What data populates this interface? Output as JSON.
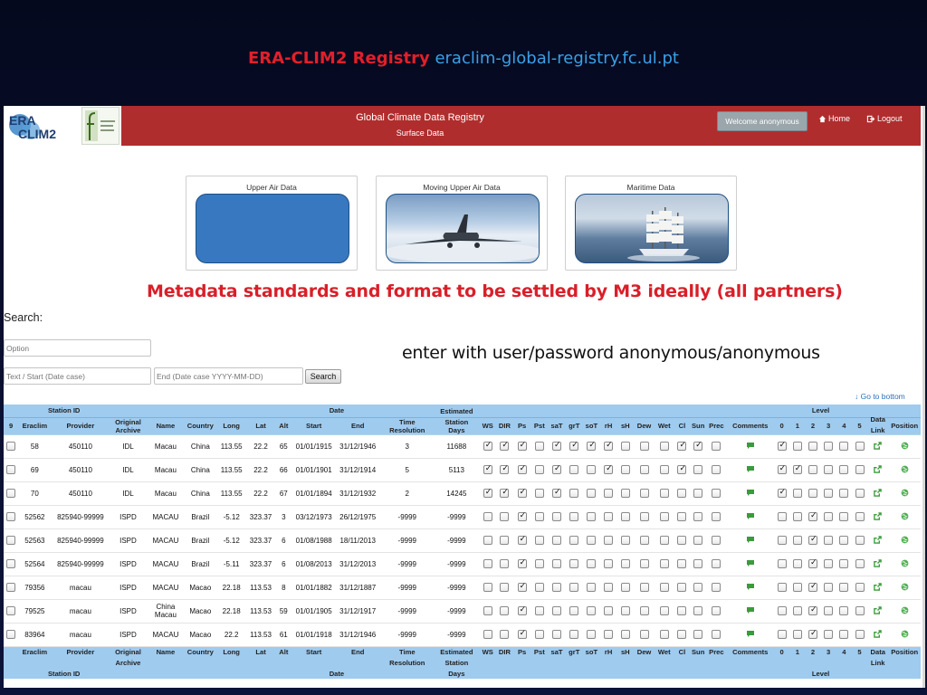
{
  "slide": {
    "title_red": "ERA-CLIM2 Registry",
    "title_blue": "eraclim-global-registry.fc.ul.pt",
    "note_red": "Metadata standards and format to be settled by M3 ideally (all partners)",
    "note_black": "enter with user/password anonymous/anonymous"
  },
  "navbar": {
    "title": "Global Climate Data Registry",
    "subtitle": "Surface Data",
    "welcome": "Welcome anonymous",
    "home": "Home",
    "logout": "Logout",
    "logo_text_era": "ERA",
    "logo_text_clim": "CLIM2"
  },
  "cards": [
    {
      "label": "Upper Air Data"
    },
    {
      "label": "Moving Upper Air Data"
    },
    {
      "label": "Maritime Data"
    }
  ],
  "search": {
    "label": "Search:",
    "option_placeholder": "Option",
    "start_placeholder": "Text / Start (Date case)",
    "end_placeholder": "End (Date case YYYY-MM-DD)",
    "button": "Search",
    "go_bottom": "Go to bottom"
  },
  "table": {
    "group_headers": {
      "station_id": "Station ID",
      "date": "Date",
      "level": "Level"
    },
    "col_headers": {
      "select": "9",
      "eraclim": "Eraclim",
      "provider": "Provider",
      "archive_1": "Original",
      "archive_2": "Archive",
      "name": "Name",
      "country": "Country",
      "long": "Long",
      "lat": "Lat",
      "alt": "Alt",
      "start": "Start",
      "end": "End",
      "time_1": "Time",
      "time_2": "Resolution",
      "est_1": "Estimated",
      "est_2": "Station",
      "est_3": "Days",
      "vars": [
        "WS",
        "DIR",
        "Ps",
        "Pst",
        "saT",
        "grT",
        "soT",
        "rH",
        "sH",
        "Dew",
        "Wet",
        "Cl",
        "Sun",
        "Prec"
      ],
      "comments": "Comments",
      "levels": [
        "0",
        "1",
        "2",
        "3",
        "4",
        "5"
      ],
      "data_link_1": "Data",
      "data_link_2": "Link",
      "position": "Position"
    },
    "rows": [
      {
        "eraclim": "58",
        "provider": "450110",
        "archive": "IDL",
        "name": "Macau",
        "country": "China",
        "long": "113.55",
        "lat": "22.2",
        "alt": "65",
        "start": "01/01/1915",
        "end": "31/12/1946",
        "time": "3",
        "days": "11688",
        "vars": [
          1,
          1,
          1,
          0,
          1,
          1,
          1,
          1,
          0,
          0,
          0,
          1,
          1,
          0
        ],
        "levels": [
          1,
          0,
          0,
          0,
          0,
          0
        ]
      },
      {
        "eraclim": "69",
        "provider": "450110",
        "archive": "IDL",
        "name": "Macau",
        "country": "China",
        "long": "113.55",
        "lat": "22.2",
        "alt": "66",
        "start": "01/01/1901",
        "end": "31/12/1914",
        "time": "5",
        "days": "5113",
        "vars": [
          1,
          1,
          1,
          0,
          1,
          0,
          0,
          1,
          0,
          0,
          0,
          1,
          0,
          0
        ],
        "levels": [
          1,
          1,
          0,
          0,
          0,
          0
        ]
      },
      {
        "eraclim": "70",
        "provider": "450110",
        "archive": "IDL",
        "name": "Macau",
        "country": "China",
        "long": "113.55",
        "lat": "22.2",
        "alt": "67",
        "start": "01/01/1894",
        "end": "31/12/1932",
        "time": "2",
        "days": "14245",
        "vars": [
          1,
          1,
          1,
          0,
          1,
          0,
          0,
          0,
          0,
          0,
          0,
          0,
          0,
          0
        ],
        "levels": [
          1,
          0,
          0,
          0,
          0,
          0
        ]
      },
      {
        "eraclim": "52562",
        "provider": "825940-99999",
        "archive": "ISPD",
        "name": "MACAU",
        "country": "Brazil",
        "long": "-5.12",
        "lat": "323.37",
        "alt": "3",
        "start": "03/12/1973",
        "end": "26/12/1975",
        "time": "-9999",
        "days": "-9999",
        "vars": [
          0,
          0,
          1,
          0,
          0,
          0,
          0,
          0,
          0,
          0,
          0,
          0,
          0,
          0
        ],
        "levels": [
          0,
          0,
          1,
          0,
          0,
          0
        ]
      },
      {
        "eraclim": "52563",
        "provider": "825940-99999",
        "archive": "ISPD",
        "name": "MACAU",
        "country": "Brazil",
        "long": "-5.12",
        "lat": "323.37",
        "alt": "6",
        "start": "01/08/1988",
        "end": "18/11/2013",
        "time": "-9999",
        "days": "-9999",
        "vars": [
          0,
          0,
          1,
          0,
          0,
          0,
          0,
          0,
          0,
          0,
          0,
          0,
          0,
          0
        ],
        "levels": [
          0,
          0,
          1,
          0,
          0,
          0
        ]
      },
      {
        "eraclim": "52564",
        "provider": "825940-99999",
        "archive": "ISPD",
        "name": "MACAU",
        "country": "Brazil",
        "long": "-5.11",
        "lat": "323.37",
        "alt": "6",
        "start": "01/08/2013",
        "end": "31/12/2013",
        "time": "-9999",
        "days": "-9999",
        "vars": [
          0,
          0,
          1,
          0,
          0,
          0,
          0,
          0,
          0,
          0,
          0,
          0,
          0,
          0
        ],
        "levels": [
          0,
          0,
          1,
          0,
          0,
          0
        ]
      },
      {
        "eraclim": "79356",
        "provider": "macau",
        "archive": "ISPD",
        "name": "MACAU",
        "country": "Macao",
        "long": "22.18",
        "lat": "113.53",
        "alt": "8",
        "start": "01/01/1882",
        "end": "31/12/1887",
        "time": "-9999",
        "days": "-9999",
        "vars": [
          0,
          0,
          1,
          0,
          0,
          0,
          0,
          0,
          0,
          0,
          0,
          0,
          0,
          0
        ],
        "levels": [
          0,
          0,
          1,
          0,
          0,
          0
        ]
      },
      {
        "eraclim": "79525",
        "provider": "macau",
        "archive": "ISPD",
        "name": "China Macau",
        "country": "Macao",
        "long": "22.18",
        "lat": "113.53",
        "alt": "59",
        "start": "01/01/1905",
        "end": "31/12/1917",
        "time": "-9999",
        "days": "-9999",
        "vars": [
          0,
          0,
          1,
          0,
          0,
          0,
          0,
          0,
          0,
          0,
          0,
          0,
          0,
          0
        ],
        "levels": [
          0,
          0,
          1,
          0,
          0,
          0
        ]
      },
      {
        "eraclim": "83964",
        "provider": "macau",
        "archive": "ISPD",
        "name": "MACAU",
        "country": "Macao",
        "long": "22.2",
        "lat": "113.53",
        "alt": "61",
        "start": "01/01/1918",
        "end": "31/12/1946",
        "time": "-9999",
        "days": "-9999",
        "vars": [
          0,
          0,
          1,
          0,
          0,
          0,
          0,
          0,
          0,
          0,
          0,
          0,
          0,
          0
        ],
        "levels": [
          0,
          0,
          1,
          0,
          0,
          0
        ]
      }
    ]
  },
  "colors": {
    "navbar": "#b02d2e",
    "header_blue": "#9fcbef",
    "title_red": "#e0202a",
    "title_blue": "#3aa0e6"
  },
  "icons": {
    "comment": "comment-icon",
    "data_link": "external-link-icon",
    "position": "globe-icon",
    "home": "home-icon",
    "logout": "logout-icon",
    "go_bottom": "arrow-down-icon"
  }
}
